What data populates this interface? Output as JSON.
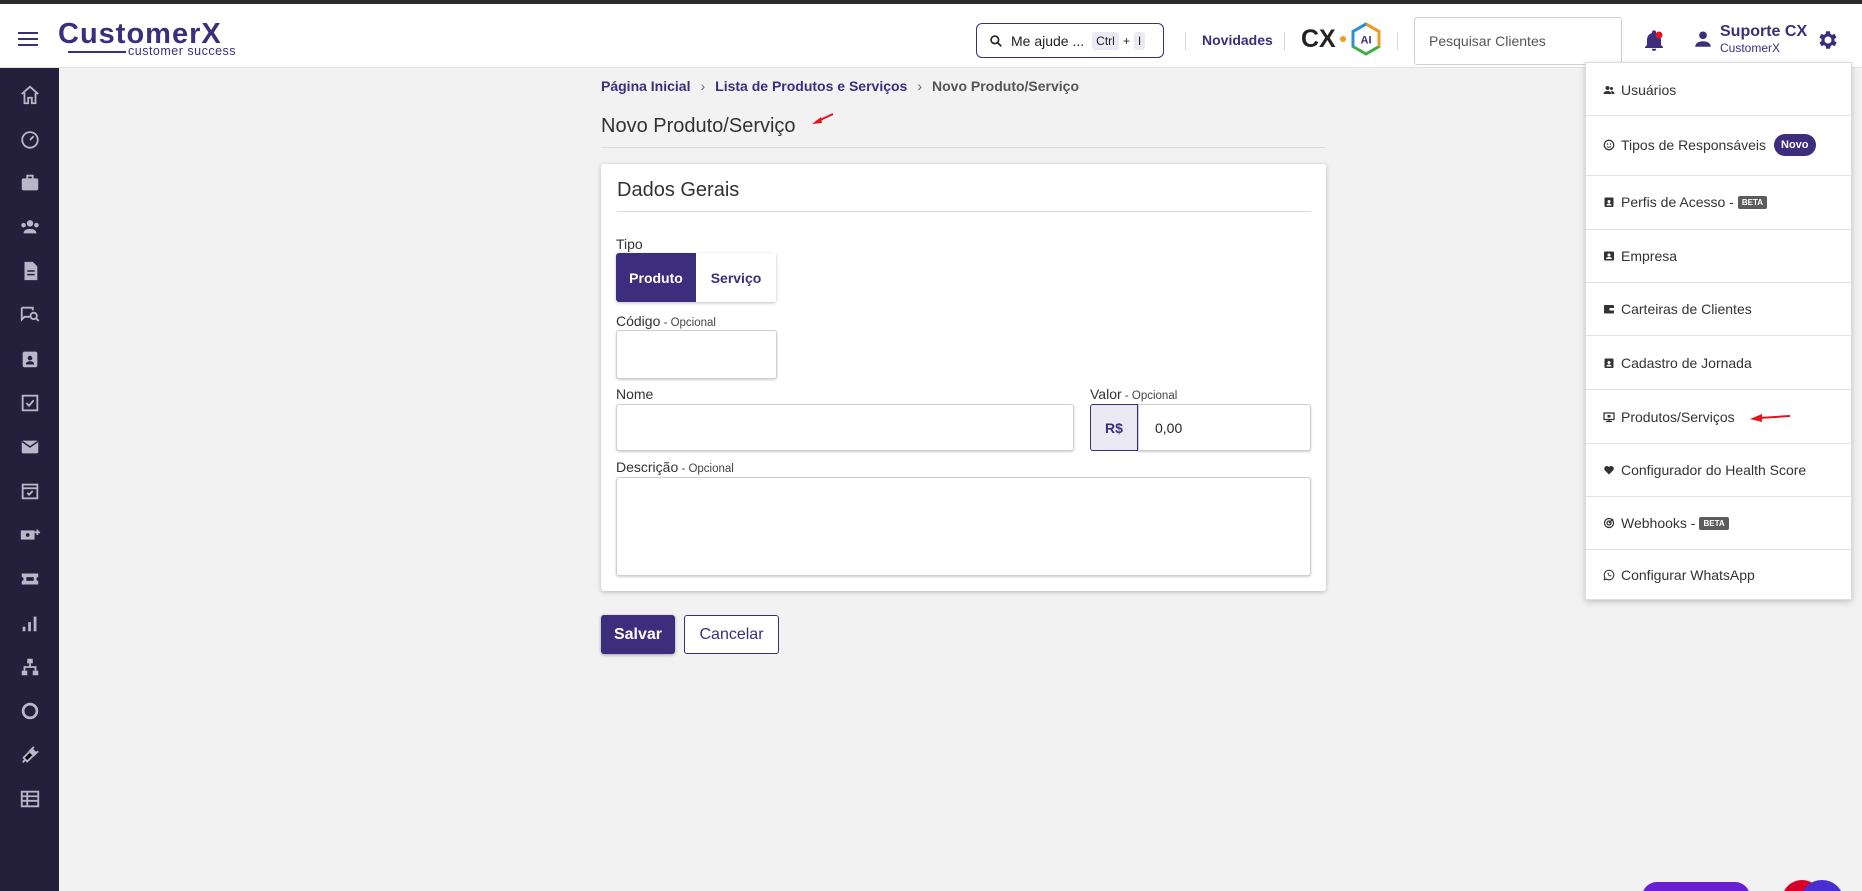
{
  "app": {
    "logo_text": "CustomerX",
    "logo_tagline": "customer success"
  },
  "header": {
    "help_label": "Me ajude ...",
    "help_shortcut_ctrl": "Ctrl",
    "help_shortcut_plus": "+",
    "help_shortcut_key": "I",
    "novidades_label": "Novidades",
    "cx_label": "CX",
    "ai_label": "AI",
    "search_placeholder": "Pesquisar Clientes",
    "user_name": "Suporte CX",
    "user_company": "CustomerX"
  },
  "breadcrumb": {
    "home": "Página Inicial",
    "list": "Lista de Produtos e Serviços",
    "current": "Novo Produto/Serviço"
  },
  "page": {
    "title": "Novo Produto/Serviço"
  },
  "form": {
    "section_title": "Dados Gerais",
    "tipo_label": "Tipo",
    "tipo_options": [
      "Produto",
      "Serviço"
    ],
    "tipo_selected": "Produto",
    "codigo_label": "Código",
    "optional_suffix": " - Opcional",
    "nome_label": "Nome",
    "valor_label": "Valor",
    "currency_prefix": "R$",
    "valor_value": "0,00",
    "descricao_label": "Descrição"
  },
  "actions": {
    "save": "Salvar",
    "cancel": "Cancelar"
  },
  "settings_menu": {
    "items": [
      {
        "label": "Usuários",
        "icon": "users-icon"
      },
      {
        "label": "Tipos de Responsáveis",
        "icon": "face-icon",
        "badge": "Novo"
      },
      {
        "label": "Perfis de Acesso -",
        "icon": "id-badge-icon",
        "badge": "BETA"
      },
      {
        "label": "Empresa",
        "icon": "contact-card-icon"
      },
      {
        "label": "Carteiras de Clientes",
        "icon": "wallet-icon"
      },
      {
        "label": "Cadastro de Jornada",
        "icon": "id-badge-icon"
      },
      {
        "label": "Produtos/Serviços",
        "icon": "product-screen-icon"
      },
      {
        "label": "Configurador do Health Score",
        "icon": "heart-icon"
      },
      {
        "label": "Webhooks -",
        "icon": "webhook-icon",
        "badge": "BETA"
      },
      {
        "label": "Configurar WhatsApp",
        "icon": "whatsapp-icon"
      }
    ]
  },
  "sidebar": {
    "icons": [
      "home-icon",
      "dashboard-icon",
      "briefcase-icon",
      "group-icon",
      "document-icon",
      "chat-search-icon",
      "contact-badge-icon",
      "checkbox-icon",
      "mail-icon",
      "calendar-check-icon",
      "money-add-icon",
      "ticket-icon",
      "bar-chart-icon",
      "hierarchy-icon",
      "donut-icon",
      "plug-icon",
      "spreadsheet-icon"
    ]
  },
  "colors": {
    "brand": "#3c2e7d",
    "sidebar": "#241f3a",
    "annotation_arrow": "#e3141b"
  }
}
